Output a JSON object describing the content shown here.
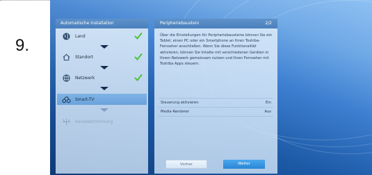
{
  "step_number": "9.",
  "left_panel": {
    "title": "Automatische Installation",
    "steps": [
      {
        "label": "Land",
        "icon": "globe-icon",
        "completed": true
      },
      {
        "label": "Standort",
        "icon": "home-icon",
        "completed": true
      },
      {
        "label": "Netzwerk",
        "icon": "network-globe-icon",
        "completed": true
      },
      {
        "label": "Smart-TV",
        "icon": "smart-tv-icon",
        "completed": false,
        "active": true
      },
      {
        "label": "Kanalabstimmung",
        "icon": "antenna-icon",
        "completed": false
      }
    ]
  },
  "right_panel": {
    "title": "Peripheriebaustein",
    "page_indicator": "2/2",
    "description": "Über die Einstellungen für Peripheriebausteine können Sie ein Tablet, einen PC oder ein Smartphone an Ihren Toshiba-Fernseher anschließen. Wenn Sie diese Funktionalität aktivieren, können Sie Inhalte mit verschiedenen Geräten in Ihrem Netzwerk gemeinsam nutzen und Ihren Fernseher mit Toshiba Apps steuern.",
    "settings": [
      {
        "label": "Steuerung aktivieren",
        "value": "Ein"
      },
      {
        "label": "Media-Renderer",
        "value": "Aus"
      }
    ],
    "buttons": {
      "back": "Vorher",
      "next": "Weiter"
    }
  },
  "colors": {
    "accent": "#2a86d6",
    "check": "#4cc23a"
  }
}
